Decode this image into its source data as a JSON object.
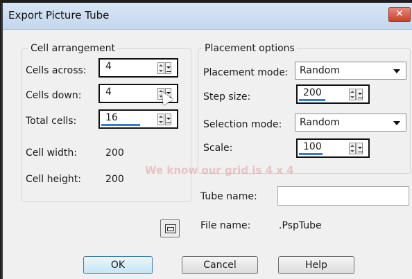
{
  "window": {
    "title": "Export Picture Tube",
    "close_glyph": "✕"
  },
  "cell_arrangement": {
    "legend": "Cell arrangement",
    "cells_across": {
      "label": "Cells across:",
      "value": "4"
    },
    "cells_down": {
      "label": "Cells down:",
      "value": "4"
    },
    "total_cells": {
      "label": "Total cells:",
      "value": "16"
    },
    "cell_width": {
      "label": "Cell width:",
      "value": "200"
    },
    "cell_height": {
      "label": "Cell height:",
      "value": "200"
    }
  },
  "placement_options": {
    "legend": "Placement options",
    "placement_mode": {
      "label": "Placement mode:",
      "value": "Random"
    },
    "step_size": {
      "label": "Step size:",
      "value": "200"
    },
    "selection_mode": {
      "label": "Selection mode:",
      "value": "Random"
    },
    "scale": {
      "label": "Scale:",
      "value": "100"
    }
  },
  "tube_name": {
    "label": "Tube name:",
    "value": ""
  },
  "file_name": {
    "label": "File name:",
    "value": ".PspTube"
  },
  "overlay_text": "We know our grid is 4 x 4",
  "buttons": {
    "ok": "OK",
    "cancel": "Cancel",
    "help": "Help"
  },
  "icons": {
    "folder_button": "folder-icon",
    "close": "close-icon"
  }
}
